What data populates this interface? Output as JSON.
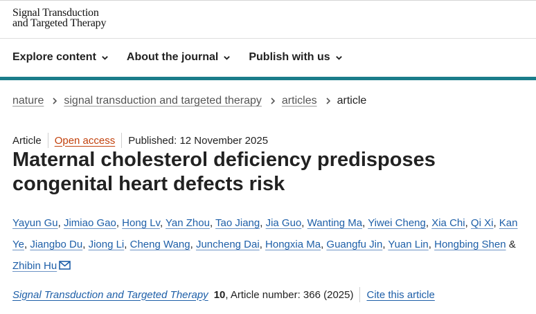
{
  "header": {
    "logo_line1": "Signal Transduction",
    "logo_line2": "and Targeted Therapy"
  },
  "nav": {
    "items": [
      {
        "label": "Explore content"
      },
      {
        "label": "About the journal"
      },
      {
        "label": "Publish with us"
      }
    ]
  },
  "breadcrumb": [
    {
      "label": "nature"
    },
    {
      "label": "signal transduction and targeted therapy"
    },
    {
      "label": "articles"
    },
    {
      "label": "article"
    }
  ],
  "article": {
    "type": "Article",
    "access": "Open access",
    "published": "Published: 12 November 2025",
    "title": "Maternal cholesterol deficiency predisposes congenital heart defects risk",
    "authors": [
      "Yayun Gu",
      "Jimiao Gao",
      "Hong Lv",
      "Yan Zhou",
      "Tao Jiang",
      "Jia Guo",
      "Wanting Ma",
      "Yiwei Cheng",
      "Xia Chi",
      "Qi Xi",
      "Kan Ye",
      "Jiangbo Du",
      "Jiong Li",
      "Cheng Wang",
      "Juncheng Dai",
      "Hongxia Ma",
      "Guangfu Jin",
      "Yuan Lin",
      "Hongbing Shen",
      "Zhibin Hu"
    ],
    "author_separator": ",",
    "author_final_conjunction": "&",
    "citation": {
      "journal": "Signal Transduction and Targeted Therapy",
      "volume": "10",
      "article_number": ", Article number: 366 (2025)",
      "cite_label": "Cite this article"
    }
  },
  "colors": {
    "accent_bar": "#1a7d8a",
    "link": "#1e5fa8",
    "open_access": "#c2410c"
  },
  "icons": [
    "chevron-down-icon",
    "chevron-right-icon",
    "envelope-icon"
  ]
}
